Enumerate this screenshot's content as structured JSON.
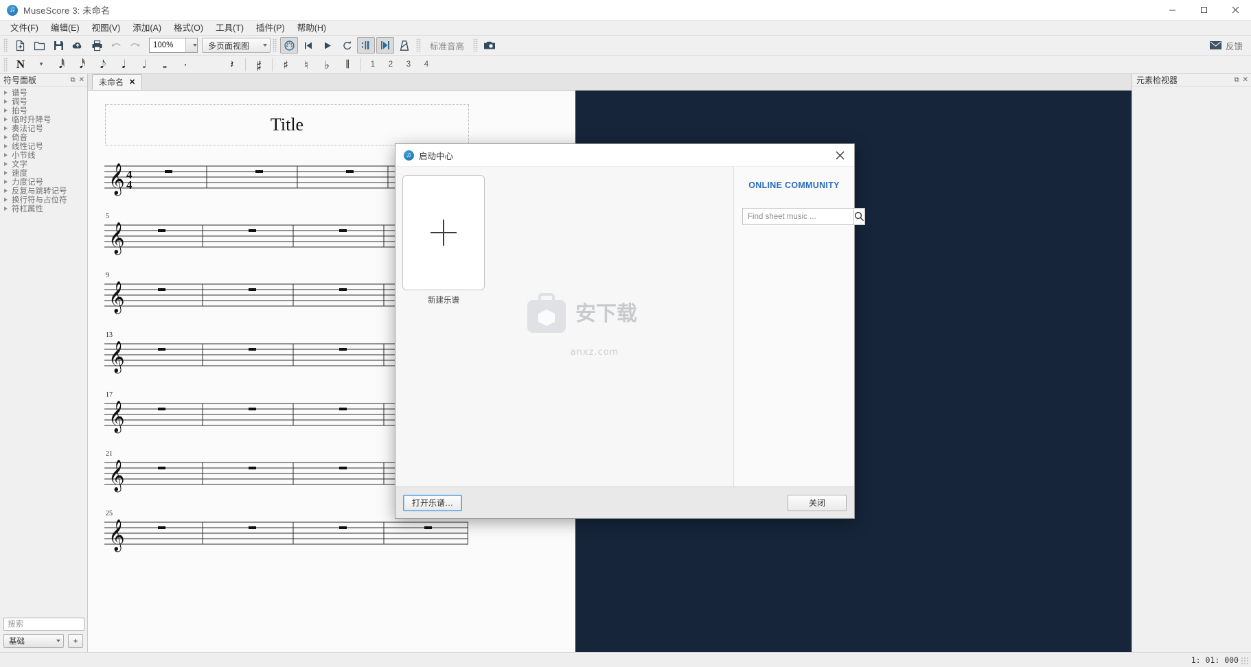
{
  "window": {
    "title": "MuseScore 3: 未命名",
    "minimize": "—",
    "maximize": "▢",
    "close": "✕"
  },
  "menubar": {
    "items": [
      {
        "label": "文件(F)"
      },
      {
        "label": "编辑(E)"
      },
      {
        "label": "视图(V)"
      },
      {
        "label": "添加(A)"
      },
      {
        "label": "格式(O)"
      },
      {
        "label": "工具(T)"
      },
      {
        "label": "插件(P)"
      },
      {
        "label": "帮助(H)"
      }
    ]
  },
  "toolbar": {
    "zoom_value": "100%",
    "view_mode": "多页面视图",
    "concert_pitch": "标准音高",
    "feedback": "反馈",
    "buttons": [
      {
        "name": "new-score-icon"
      },
      {
        "name": "open-score-icon"
      },
      {
        "name": "save-score-icon"
      },
      {
        "name": "save-online-icon"
      },
      {
        "name": "print-icon"
      },
      {
        "name": "undo-icon"
      },
      {
        "name": "redo-icon"
      },
      {
        "name": "note-input-icon"
      },
      {
        "name": "rewind-icon"
      },
      {
        "name": "play-icon"
      },
      {
        "name": "loop-icon"
      },
      {
        "name": "play-repeats-icon"
      },
      {
        "name": "pan-score-icon"
      },
      {
        "name": "metronome-icon"
      },
      {
        "name": "screenshot-icon"
      }
    ]
  },
  "note_toolbar": {
    "items": [
      {
        "label": "N",
        "name": "note-input-mode"
      },
      {
        "label": "▾",
        "name": "note-input-dropdown"
      },
      {
        "label": "𝅘𝅥𝅱",
        "name": "duration-64th"
      },
      {
        "label": "𝅘𝅥𝅰",
        "name": "duration-32nd"
      },
      {
        "label": "𝅘𝅥𝅮",
        "name": "duration-eighth"
      },
      {
        "label": "𝅘𝅥",
        "name": "duration-quarter"
      },
      {
        "label": "𝅗𝅥",
        "name": "duration-half"
      },
      {
        "label": "𝅝",
        "name": "duration-whole"
      },
      {
        "label": "·",
        "name": "duration-dot"
      },
      {
        "label": "𝄽",
        "name": "rest-icon"
      },
      {
        "label": "𝄰",
        "name": "tie-icon"
      },
      {
        "label": "♯",
        "name": "sharp-icon"
      },
      {
        "label": "♮",
        "name": "natural-icon"
      },
      {
        "label": "♭",
        "name": "flat-icon"
      },
      {
        "label": "𝄂",
        "name": "flip-icon"
      },
      {
        "label": "1",
        "name": "voice-1"
      },
      {
        "label": "2",
        "name": "voice-2"
      },
      {
        "label": "3",
        "name": "voice-3"
      },
      {
        "label": "4",
        "name": "voice-4"
      }
    ]
  },
  "palette": {
    "header": "符号面板",
    "items": [
      {
        "label": "谱号"
      },
      {
        "label": "调号"
      },
      {
        "label": "拍号"
      },
      {
        "label": "临时升降号"
      },
      {
        "label": "奏法记号"
      },
      {
        "label": "倚音"
      },
      {
        "label": "线性记号"
      },
      {
        "label": "小节线"
      },
      {
        "label": "文字"
      },
      {
        "label": "速度"
      },
      {
        "label": "力度记号"
      },
      {
        "label": "反复与跳转记号"
      },
      {
        "label": "换行符与占位符"
      },
      {
        "label": "符杠属性"
      }
    ],
    "search_placeholder": "搜索",
    "workspace": "基础",
    "add_workspace": "+"
  },
  "document": {
    "tab_label": "未命名",
    "tab_close": "✕",
    "score_title": "Title",
    "time_signature": "4/4",
    "systems": [
      {
        "measure_number": "",
        "measures": 4
      },
      {
        "measure_number": "5",
        "measures": 4
      },
      {
        "measure_number": "9",
        "measures": 4
      },
      {
        "measure_number": "13",
        "measures": 4
      },
      {
        "measure_number": "17",
        "measures": 4
      },
      {
        "measure_number": "21",
        "measures": 4
      },
      {
        "measure_number": "25",
        "measures": 4
      }
    ]
  },
  "inspector": {
    "header": "元素检视器"
  },
  "statusbar": {
    "position": "1: 01: 000"
  },
  "start_center": {
    "title": "启动中心",
    "close_icon": "✕",
    "new_score_label": "新建乐谱",
    "new_score_plus": "+",
    "online_community": "ONLINE COMMUNITY",
    "find_placeholder": "Find sheet music ...",
    "search_icon": "search-icon",
    "watermark_primary": "安下载",
    "watermark_secondary": "anxz.com",
    "open_score_button": "打开乐谱…",
    "close_button": "关闭"
  },
  "colors": {
    "canvas_bg": "#16253a",
    "accent_blue": "#2a6ebb",
    "chrome_gray": "#f0f0f0"
  }
}
